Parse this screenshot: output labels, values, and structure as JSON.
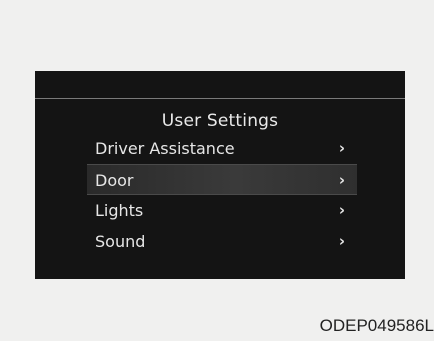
{
  "screen": {
    "title": "User Settings",
    "menu_items": [
      {
        "label": "Driver Assistance",
        "chevron": "›"
      },
      {
        "label": "Door",
        "chevron": "›",
        "selected": true
      },
      {
        "label": "Lights",
        "chevron": "›"
      },
      {
        "label": "Sound",
        "chevron": "›"
      }
    ]
  },
  "figure_code": "ODEP049586L",
  "colors": {
    "background": "#f0f0ef",
    "panel": "#141414",
    "text": "#e6e6e6",
    "selected_row": "#3a3a3a"
  }
}
